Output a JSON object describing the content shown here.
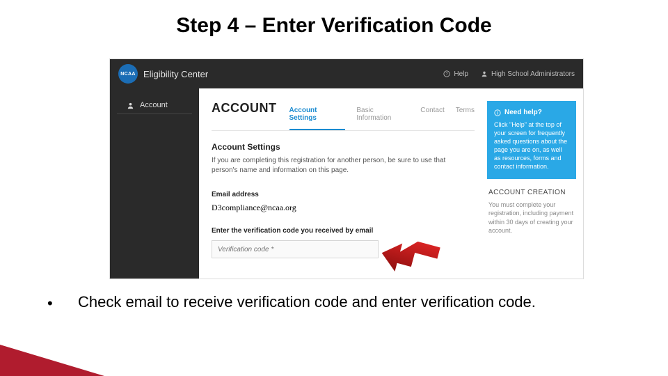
{
  "slide": {
    "title": "Step 4 – Enter Verification Code",
    "bullet": "Check email to receive verification code and enter verification code."
  },
  "topbar": {
    "brand": "Eligibility Center",
    "logo_text": "NCAA",
    "help": "Help",
    "admin": "High School Administrators"
  },
  "sidebar": {
    "account": "Account"
  },
  "main": {
    "title": "ACCOUNT",
    "tabs": {
      "settings": "Account Settings",
      "basic": "Basic Information",
      "contact": "Contact",
      "terms": "Terms"
    },
    "section_title": "Account Settings",
    "section_desc": "If you are completing this registration for another person, be sure to use that person's name and information on this page.",
    "email_label": "Email address",
    "email_value": "D3compliance@ncaa.org",
    "verif_label": "Enter the verification code you received by email",
    "verif_placeholder": "Verification code *"
  },
  "help": {
    "title": "Need help?",
    "body": "Click \"Help\" at the top of your screen for frequently asked questions about the page you are on, as well as resources, forms and contact information."
  },
  "account_creation": {
    "title": "ACCOUNT CREATION",
    "body": "You must complete your registration, including payment within 30 days of creating your account."
  }
}
